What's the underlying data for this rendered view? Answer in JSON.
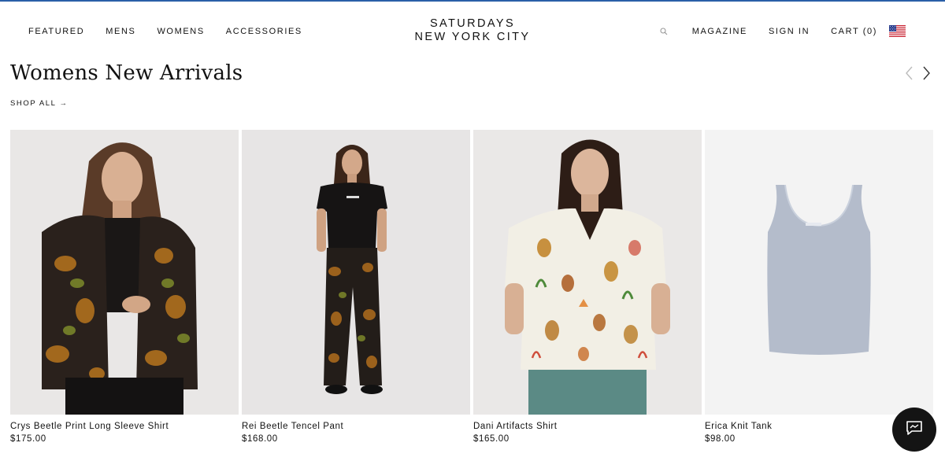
{
  "header": {
    "nav_left": [
      "FEATURED",
      "MENS",
      "WOMENS",
      "ACCESSORIES"
    ],
    "logo": {
      "line1": "SATURDAYS",
      "line2": "NEW YORK CITY"
    },
    "nav_right": {
      "magazine": "MAGAZINE",
      "sign_in": "SIGN IN",
      "cart": "CART (0)"
    },
    "icons": {
      "search": "search-icon",
      "flag": "us-flag-icon"
    }
  },
  "section": {
    "title": "Womens New Arrivals",
    "shop_all": "SHOP ALL →",
    "icons": {
      "prev": "chevron-left-icon",
      "next": "chevron-right-icon"
    }
  },
  "products": [
    {
      "name": "Crys Beetle Print Long Sleeve Shirt",
      "price": "$175.00"
    },
    {
      "name": "Rei Beetle Tencel Pant",
      "price": "$168.00"
    },
    {
      "name": "Dani Artifacts Shirt",
      "price": "$165.00"
    },
    {
      "name": "Erica Knit Tank",
      "price": "$98.00"
    }
  ],
  "chat": {
    "icon": "chat-icon"
  },
  "colors": {
    "accent_line": "#2a5fa8",
    "text": "#111111",
    "chat_bg": "#141414",
    "image_bg": "#eceaea"
  }
}
